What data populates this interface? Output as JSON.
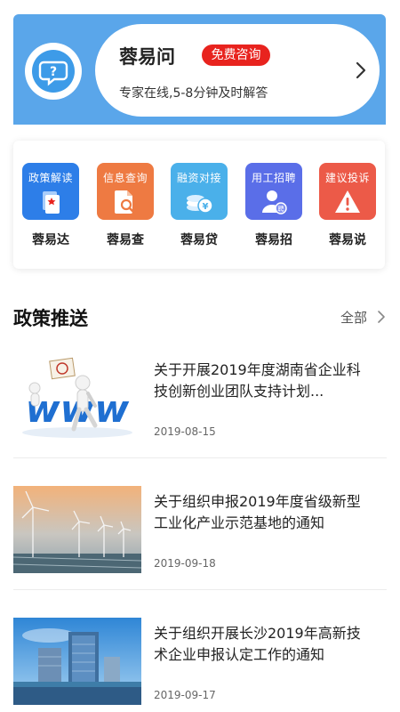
{
  "banner": {
    "title": "蓉易问",
    "badge": "免费咨询",
    "subtitle": "专家在线,5-8分钟及时解答",
    "icon": "question-chat-icon",
    "color": "#5aa6ea"
  },
  "services": [
    {
      "tile_text": "政策解读",
      "label": "蓉易达",
      "icon": "document-icon",
      "color": "#2d7ee8"
    },
    {
      "tile_text": "信息查询",
      "label": "蓉易查",
      "icon": "file-search-icon",
      "color": "#ee7a42"
    },
    {
      "tile_text": "融资对接",
      "label": "蓉易贷",
      "icon": "coins-icon",
      "color": "#4ab0ea"
    },
    {
      "tile_text": "用工招聘",
      "label": "蓉易招",
      "icon": "recruit-person-icon",
      "color": "#5a6ee8"
    },
    {
      "tile_text": "建议投诉",
      "label": "蓉易说",
      "icon": "warning-icon",
      "color": "#ec5a48"
    }
  ],
  "policy": {
    "title": "政策推送",
    "more": "全部"
  },
  "news": [
    {
      "title": "关于开展2019年度湖南省企业科技创新创业团队支持计划...",
      "date": "2019-08-15",
      "thumb": "www-innovation-image"
    },
    {
      "title": "关于组织申报2019年度省级新型工业化产业示范基地的通知",
      "date": "2019-09-18",
      "thumb": "wind-turbines-image"
    },
    {
      "title": "关于组织开展长沙2019年高新技术企业申报认定工作的通知",
      "date": "2019-09-17",
      "thumb": "city-buildings-image"
    }
  ]
}
